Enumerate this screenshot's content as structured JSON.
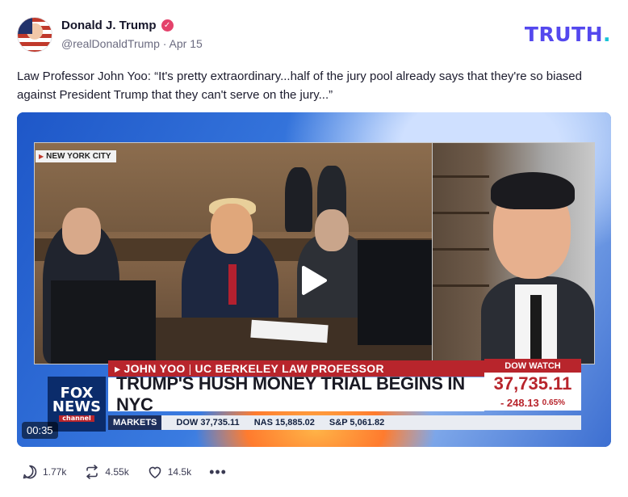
{
  "author": {
    "display_name": "Donald J. Trump",
    "handle": "@realDonaldTrump",
    "separator": "·",
    "date": "Apr 15",
    "verified_icon": "check"
  },
  "logo": {
    "text": "TRUTH",
    "dot": ".",
    "color": "#5448ee",
    "dot_color": "#18c3d6"
  },
  "post": {
    "text": "Law Professor John Yoo: “It's pretty extraordinary...half of the jury pool already says that they're so biased against President Trump that they can't serve on the jury...”"
  },
  "video": {
    "duration": "00:35",
    "location_tag": "NEW YORK CITY",
    "lower_third": {
      "name": "JOHN YOO",
      "sep": "|",
      "title": "UC BERKELEY LAW PROFESSOR",
      "headline": "TRUMP'S HUSH MONEY TRIAL BEGINS IN NYC",
      "network_line1": "FOX",
      "network_line2": "NEWS",
      "network_line3": "channel",
      "dow_label": "DOW WATCH",
      "dow_value": "37,735.11",
      "dow_change": "- 248.13",
      "dow_pct": "0.65%",
      "ticker": [
        {
          "label": "MARKETS"
        },
        {
          "label": "DOW",
          "value": "37,735.11"
        },
        {
          "label": "NAS",
          "value": "15,885.02"
        },
        {
          "label": "S&P",
          "value": "5,061.82"
        }
      ]
    }
  },
  "actions": {
    "replies": "1.77k",
    "retruths": "4.55k",
    "likes": "14.5k",
    "more": "•••"
  }
}
